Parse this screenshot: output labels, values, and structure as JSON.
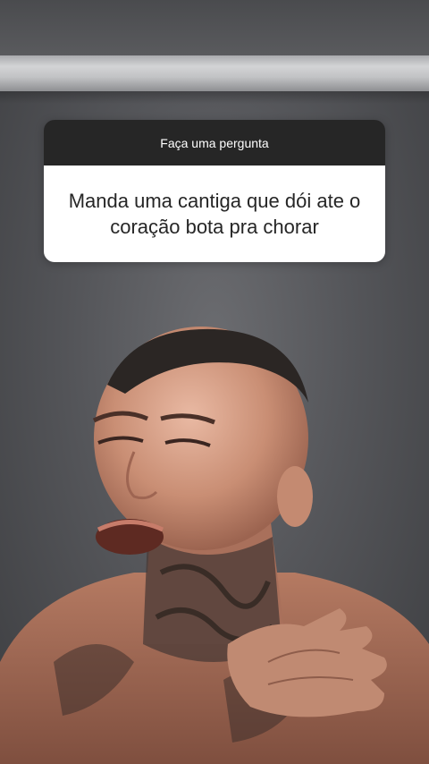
{
  "question_sticker": {
    "header": "Faça uma pergunta",
    "lines": [
      "Manda uma cantiga que dói ate o",
      "coração bota pra chorar"
    ]
  },
  "colors": {
    "sticker_header_bg": "#262626",
    "sticker_body_bg": "#ffffff",
    "sticker_text": "#262626"
  },
  "background": {
    "description_icon": "photo-background"
  }
}
